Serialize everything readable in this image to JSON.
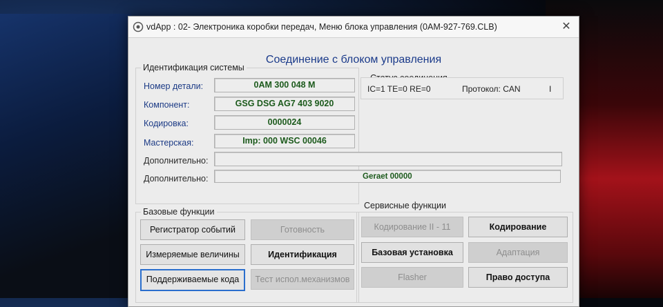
{
  "window": {
    "title": "vdApp : 02- Электроника коробки передач,  Меню блока управления (0AM-927-769.CLB)",
    "close_symbol": "✕"
  },
  "header": {
    "title": "Соединение с блоком управления"
  },
  "identification": {
    "section_label": "Идентификация системы",
    "fields": [
      {
        "label": "Номер детали:",
        "value": "0AM 300 048 M"
      },
      {
        "label": "Компонент:",
        "value": "GSG DSG AG7     403 9020"
      },
      {
        "label": "Кодировка:",
        "value": "0000024"
      },
      {
        "label": "Мастерская:",
        "value": "Imp: 000     WSC 00046"
      },
      {
        "label": "Дополнительно:",
        "value": ""
      },
      {
        "label": "Дополнительно:",
        "value": "Geraet 00000"
      }
    ]
  },
  "connection_status": {
    "label": "Статус соединения",
    "counters": "IC=1  TE=0  RE=0",
    "protocol": "Протокол: CAN",
    "indicator": "I"
  },
  "basic_functions": {
    "label": "Базовые функции",
    "buttons": [
      {
        "label": "Регистратор событий",
        "enabled": true
      },
      {
        "label": "Готовность",
        "enabled": false
      },
      {
        "label": "Измеряемые величины",
        "enabled": true
      },
      {
        "label": "Идентификация",
        "enabled": true
      },
      {
        "label": "Поддерживаемые кода",
        "enabled": true,
        "focused": true
      },
      {
        "label": "Тест испол.механизмов",
        "enabled": false
      }
    ]
  },
  "service_functions": {
    "label": "Сервисные функции",
    "buttons": [
      {
        "label": "Кодирование II - 11",
        "enabled": false
      },
      {
        "label": "Кодирование",
        "enabled": true
      },
      {
        "label": "Базовая установка",
        "enabled": true
      },
      {
        "label": "Адаптация",
        "enabled": false
      },
      {
        "label": "Flasher",
        "enabled": false
      },
      {
        "label": "Право доступа",
        "enabled": true
      }
    ]
  },
  "colors": {
    "title_blue": "#1a3a8a",
    "value_green": "#1c5a1c",
    "focus_blue": "#2a6ecd"
  },
  "icons": {
    "app": "gear-icon"
  }
}
